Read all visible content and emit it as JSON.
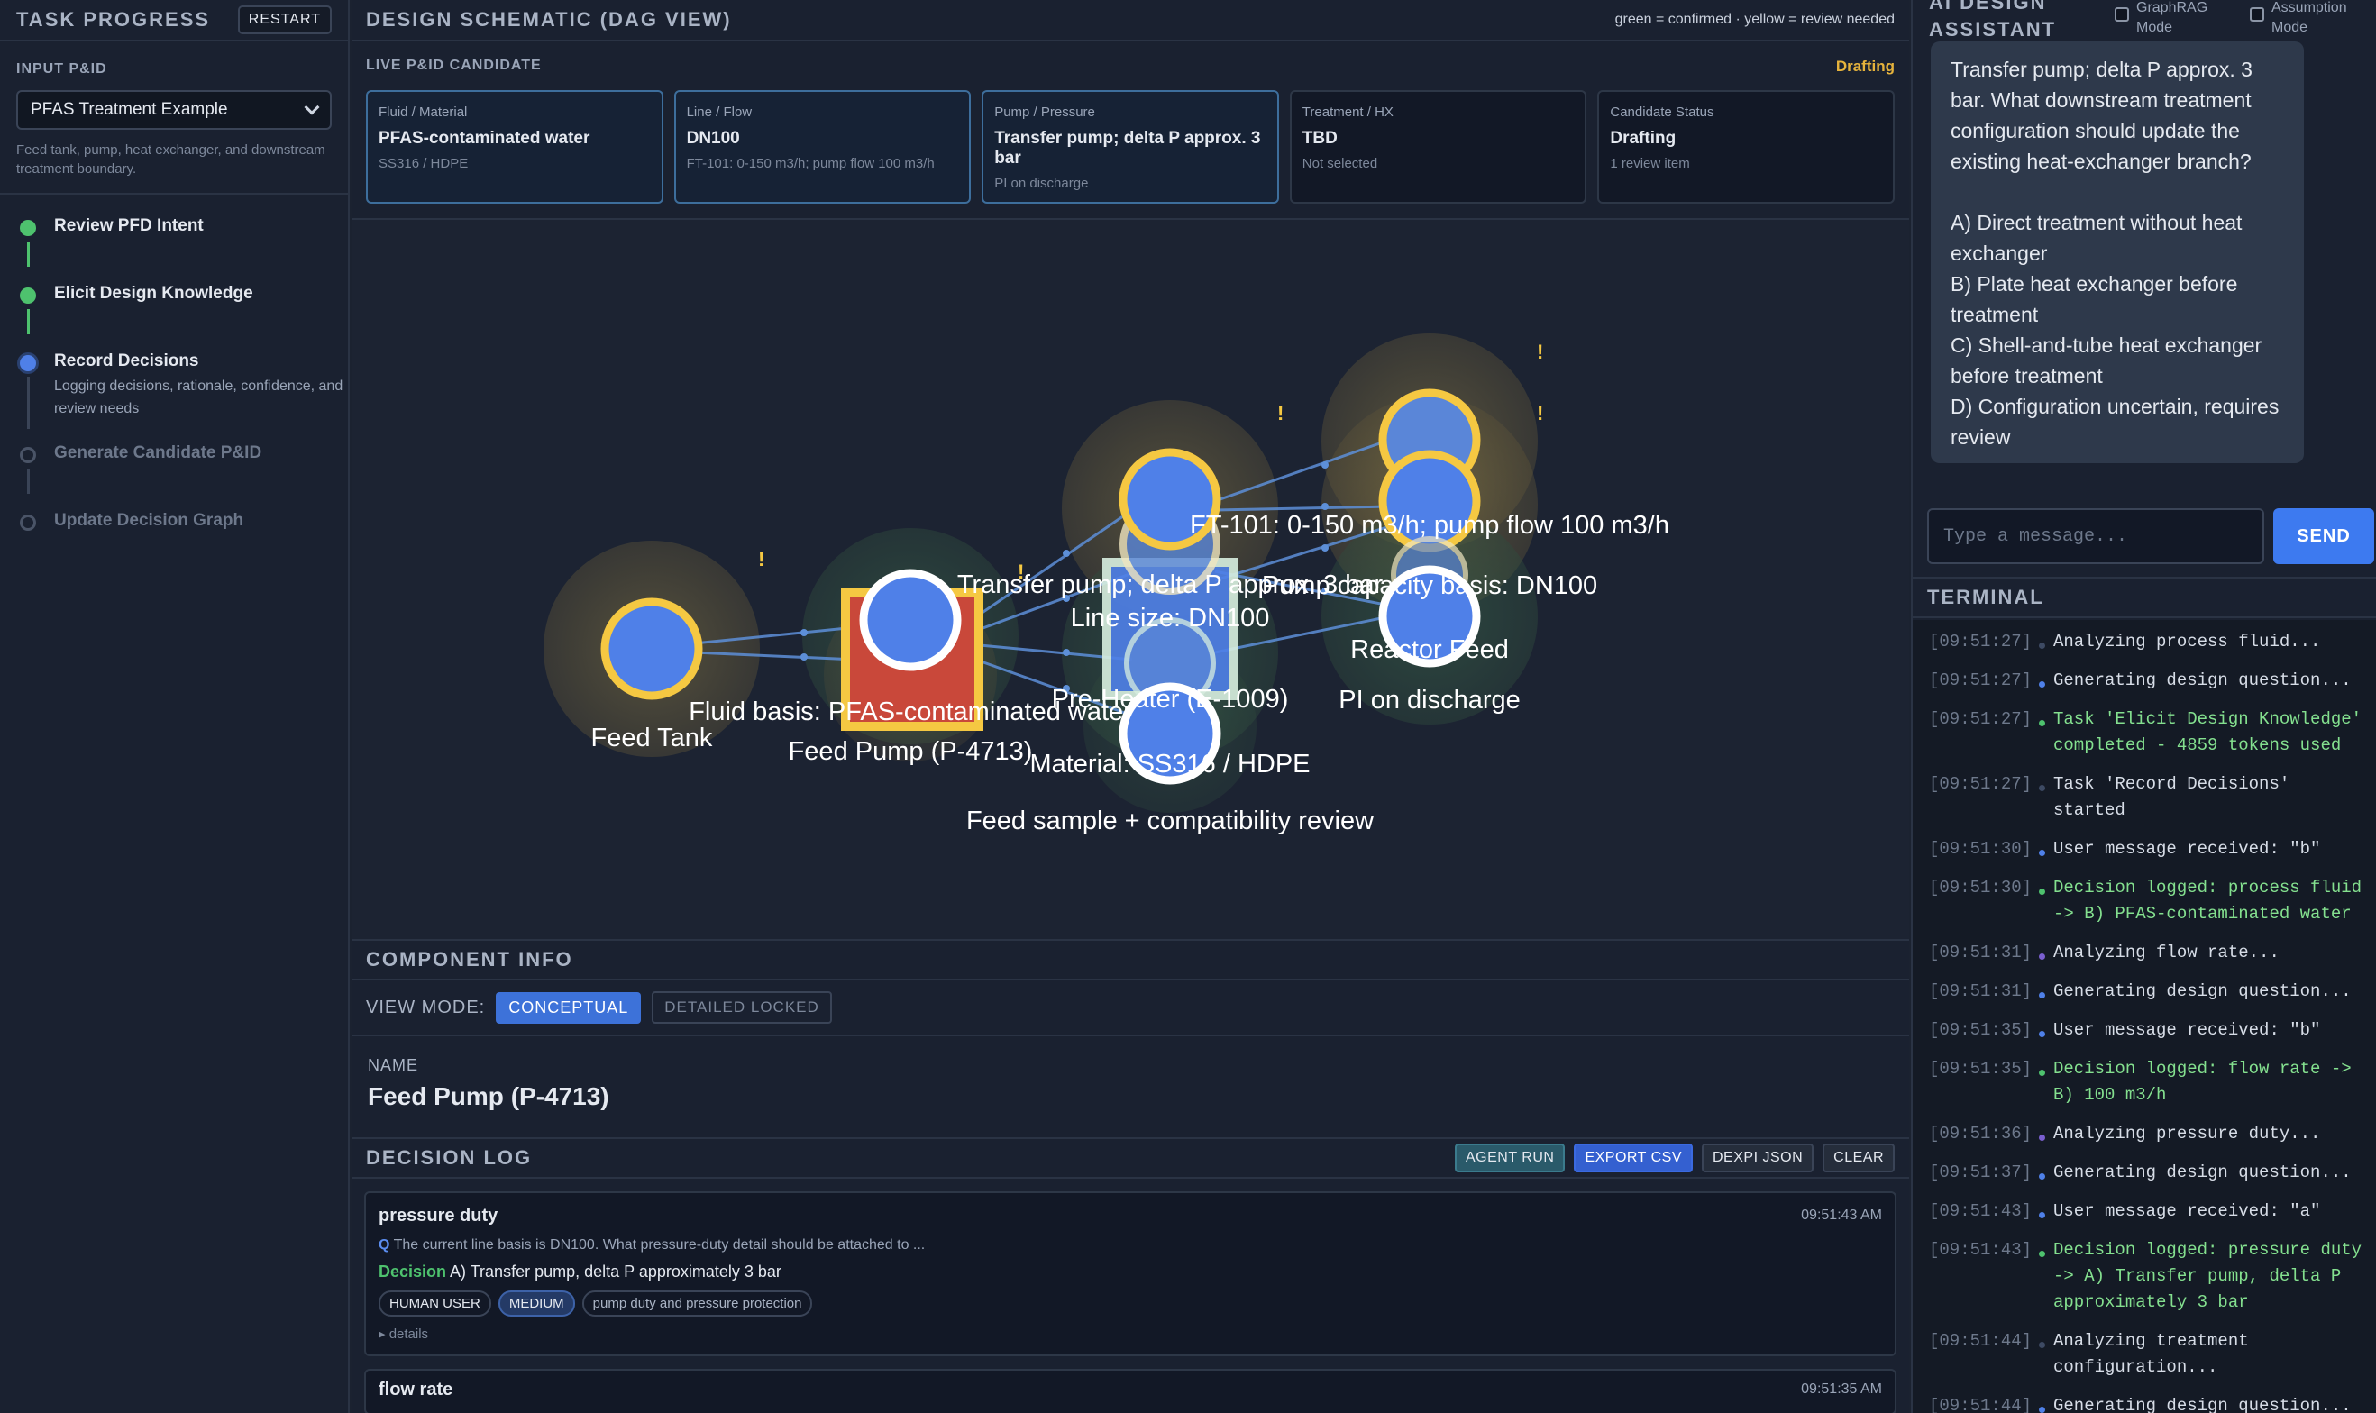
{
  "left": {
    "title": "TASK PROGRESS",
    "restart": "RESTART",
    "input_label": "INPUT P&ID",
    "select_value": "PFAS Treatment Example",
    "hint": "Feed tank, pump, heat exchanger, and downstream treatment boundary.",
    "steps": [
      {
        "title": "Review PFD Intent",
        "desc": "",
        "state": "done"
      },
      {
        "title": "Elicit Design Knowledge",
        "desc": "",
        "state": "done"
      },
      {
        "title": "Record Decisions",
        "desc": "Logging decisions, rationale, confidence, and review needs",
        "state": "active"
      },
      {
        "title": "Generate Candidate P&ID",
        "desc": "",
        "state": "pending"
      },
      {
        "title": "Update Decision Graph",
        "desc": "",
        "state": "pending"
      }
    ]
  },
  "center": {
    "title": "DESIGN SCHEMATIC (DAG VIEW)",
    "legend": "green = confirmed · yellow = review needed",
    "candidate_label": "LIVE P&ID CANDIDATE",
    "candidate_status": "Drafting",
    "cards": [
      {
        "label": "Fluid / Material",
        "value": "PFAS-contaminated water",
        "sub": "SS316 / HDPE",
        "active": true
      },
      {
        "label": "Line / Flow",
        "value": "DN100",
        "sub": "FT-101: 0-150 m3/h; pump flow 100 m3/h",
        "active": true
      },
      {
        "label": "Pump / Pressure",
        "value": "Transfer pump; delta P approx. 3 bar",
        "sub": "PI on discharge",
        "active": true
      },
      {
        "label": "Treatment / HX",
        "value": "TBD",
        "sub": "Not selected",
        "active": false
      },
      {
        "label": "Candidate Status",
        "value": "Drafting",
        "sub": "1 review item",
        "active": false
      }
    ],
    "graph_labels": {
      "feed_tank": "Feed Tank",
      "feed_pump": "Feed Pump (P-4713)",
      "fluid_basis": "Fluid basis: PFAS-contaminated water",
      "transfer_pump": "Transfer pump; delta P approx. 3 bar",
      "line_size": "Line size: DN100",
      "flow": "FT-101: 0-150 m3/h; pump flow 100 m3/h",
      "pipe_basis": "Pump capacity basis: DN100",
      "preheater": "Pre-Heater (E-1009)",
      "material": "Material: SS316 / HDPE",
      "reactor_feed": "Reactor Feed",
      "pi_discharge": "PI on discharge",
      "feed_sample": "Feed sample + compatibility review",
      "alert": "!"
    },
    "colors": {
      "node_blue": "#4f80e8",
      "review_yellow": "#f5c842",
      "pump_red": "#c9483a",
      "edge_blue": "#5d8fd8"
    },
    "comp_title": "COMPONENT INFO",
    "view_mode_label": "VIEW MODE:",
    "view_mode_on": "CONCEPTUAL",
    "view_mode_off": "DETAILED LOCKED",
    "name_label": "NAME",
    "name_value": "Feed Pump (P-4713)",
    "log_title": "DECISION LOG",
    "log_actions": [
      "AGENT RUN",
      "EXPORT CSV",
      "DEXPI JSON",
      "CLEAR"
    ],
    "entry": {
      "title": "pressure duty",
      "time": "09:51:43 AM",
      "q_prefix": "Q",
      "question": "The current line basis is DN100. What pressure-duty detail should be attached to ...",
      "decision_label": "Decision",
      "decision": "A) Transfer pump, delta P approximately 3 bar",
      "tags": [
        "HUMAN USER",
        "MEDIUM",
        "pump duty and pressure protection"
      ],
      "details": "▸ details"
    },
    "entry2": {
      "title": "flow rate",
      "time": "09:51:35 AM"
    }
  },
  "right": {
    "title": "AI DESIGN ASSISTANT",
    "graphrag": "GraphRAG Mode",
    "assumption": "Assumption Mode",
    "bubble_intro": "Transfer pump; delta P approx. 3 bar. What downstream treatment configuration should update the existing heat-exchanger branch?",
    "options": [
      "A) Direct treatment without heat exchanger",
      "B) Plate heat exchanger before treatment",
      "C) Shell-and-tube heat exchanger before treatment",
      "D) Configuration uncertain, requires review"
    ],
    "input_placeholder": "Type a message...",
    "send": "SEND",
    "terminal_title": "TERMINAL",
    "terminal": [
      {
        "ts": "[09:51:27]",
        "msg": "Analyzing process fluid...",
        "kind": "info",
        "dot": "#3d4a63"
      },
      {
        "ts": "[09:51:27]",
        "msg": "Generating design question...",
        "kind": "info",
        "dot": "#4f80e8"
      },
      {
        "ts": "[09:51:27]",
        "msg": "Task 'Elicit Design Knowledge' completed - 4859 tokens used",
        "kind": "ok",
        "dot": "#4ec26e"
      },
      {
        "ts": "[09:51:27]",
        "msg": "Task 'Record Decisions' started",
        "kind": "info",
        "dot": "#3d4a63"
      },
      {
        "ts": "[09:51:30]",
        "msg": "User message received: \"b\"",
        "kind": "info",
        "dot": "#4f80e8"
      },
      {
        "ts": "[09:51:30]",
        "msg": "Decision logged: process fluid -> B) PFAS-contaminated water",
        "kind": "ok",
        "dot": "#4ec26e"
      },
      {
        "ts": "[09:51:31]",
        "msg": "Analyzing flow rate...",
        "kind": "info",
        "dot": "#7a5fd0"
      },
      {
        "ts": "[09:51:31]",
        "msg": "Generating design question...",
        "kind": "info",
        "dot": "#4f80e8"
      },
      {
        "ts": "[09:51:35]",
        "msg": "User message received: \"b\"",
        "kind": "info",
        "dot": "#4f80e8"
      },
      {
        "ts": "[09:51:35]",
        "msg": "Decision logged: flow rate -> B) 100 m3/h",
        "kind": "ok",
        "dot": "#4ec26e"
      },
      {
        "ts": "[09:51:36]",
        "msg": "Analyzing pressure duty...",
        "kind": "info",
        "dot": "#7a5fd0"
      },
      {
        "ts": "[09:51:37]",
        "msg": "Generating design question...",
        "kind": "info",
        "dot": "#4f80e8"
      },
      {
        "ts": "[09:51:43]",
        "msg": "User message received: \"a\"",
        "kind": "info",
        "dot": "#4f80e8"
      },
      {
        "ts": "[09:51:43]",
        "msg": "Decision logged: pressure duty -> A) Transfer pump, delta P approximately 3 bar",
        "kind": "ok",
        "dot": "#4ec26e"
      },
      {
        "ts": "[09:51:44]",
        "msg": "Analyzing treatment configuration...",
        "kind": "info",
        "dot": "#3d4a63"
      },
      {
        "ts": "[09:51:44]",
        "msg": "Generating design question...",
        "kind": "info",
        "dot": "#4f80e8"
      }
    ]
  }
}
